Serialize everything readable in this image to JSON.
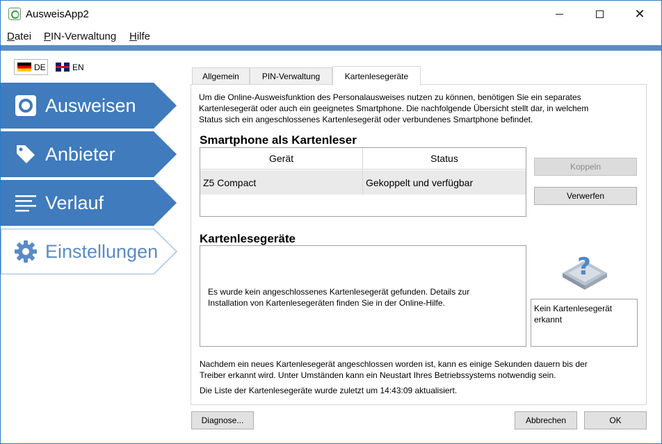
{
  "window": {
    "title": "AusweisApp2",
    "controls": {
      "minimize": "minimize-icon",
      "maximize": "maximize-icon",
      "close": "close-icon"
    }
  },
  "menu": {
    "items": [
      {
        "label": "Datei",
        "mnemonic": "D",
        "rest": "atei"
      },
      {
        "label": "PIN-Verwaltung",
        "mnemonic": "P",
        "rest": "IN-Verwaltung"
      },
      {
        "label": "Hilfe",
        "mnemonic": "H",
        "rest": "ilfe"
      }
    ]
  },
  "colors": {
    "accent": "#5b8bc6",
    "nav_active": "#3f7bbd"
  },
  "language": {
    "de": "DE",
    "en": "EN",
    "selected": "DE"
  },
  "sidebar": {
    "items": [
      {
        "label": "Ausweisen",
        "icon": "id-icon"
      },
      {
        "label": "Anbieter",
        "icon": "tag-icon"
      },
      {
        "label": "Verlauf",
        "icon": "list-icon"
      },
      {
        "label": "Einstellungen",
        "icon": "gear-icon",
        "selected": true
      }
    ]
  },
  "tabs": [
    {
      "label": "Allgemein"
    },
    {
      "label": "PIN-Verwaltung"
    },
    {
      "label": "Kartenlesegeräte",
      "active": true
    }
  ],
  "panel": {
    "intro_line1": "Um die Online-Ausweisfunktion des Personalausweises nutzen zu können, benötigen Sie ein separates",
    "intro_line2": "Kartenlesegerät oder auch ein geeignetes Smartphone. Die nachfolgende Übersicht stellt dar, in welchem",
    "intro_line3": "Status sich ein angeschlossenes Kartenlesegerät oder verbundenes Smartphone befindet.",
    "smartphone_title": "Smartphone als Kartenleser",
    "table": {
      "headers": [
        "Gerät",
        "Status"
      ],
      "rows": [
        {
          "device": "Z5 Compact",
          "status": "Gekoppelt und verfügbar"
        }
      ]
    },
    "pair_button": "Koppeln",
    "discard_button": "Verwerfen",
    "readers_title": "Kartenlesegeräte",
    "reader_msg_line1": "Es wurde kein angeschlossenes Kartenlesegerät gefunden. Details zur",
    "reader_msg_line2": "Installation von Kartenlesegeräten finden Sie in der Online-Hilfe.",
    "reader_status_line1": "Kein Kartenlesegerät",
    "reader_status_line2": "erkannt",
    "reader_icon": "unknown-reader-icon",
    "note_line1": "Nachdem ein neues Kartenlesegerät angeschlossen worden ist, kann es einige Sekunden dauern bis der",
    "note_line2": "Treiber erkannt wird. Unter Umständen kann ein Neustart Ihres Betriebssystems notwendig sein.",
    "updated_text": "Die Liste der Kartenlesegeräte wurde zuletzt um 14:43:09 aktualisiert."
  },
  "footer": {
    "diagnose": "Diagnose...",
    "cancel": "Abbrechen",
    "ok": "OK"
  }
}
